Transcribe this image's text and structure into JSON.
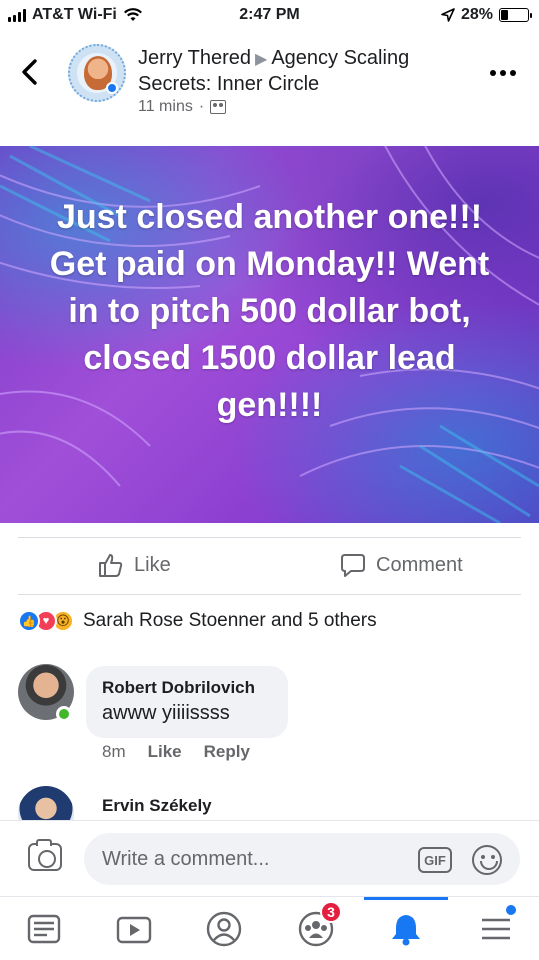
{
  "status_bar": {
    "carrier": "AT&T Wi-Fi",
    "time": "2:47 PM",
    "battery": "28%",
    "battery_level": 0.28
  },
  "post": {
    "author": "Jerry Thered",
    "group": "Agency Scaling Secrets: Inner Circle",
    "time": "11 mins",
    "separator": "·",
    "text": "Just closed another one!!! Get paid on Monday!! Went in to pitch 500 dollar bot, closed 1500 dollar lead gen!!!!"
  },
  "actions": {
    "like": "Like",
    "comment": "Comment"
  },
  "reactions": {
    "icons": [
      "like-icon",
      "love-icon",
      "wow-icon"
    ],
    "summary": "Sarah Rose Stoenner and 5 others"
  },
  "comments": [
    {
      "author": "Robert Dobrilovich",
      "text": "awww yiiiissss",
      "time": "8m",
      "like": "Like",
      "reply": "Reply",
      "online": true
    },
    {
      "author": "Ervin Székely"
    }
  ],
  "composer": {
    "placeholder": "Write a comment...",
    "gif": "GIF"
  },
  "bottom_nav": {
    "items": [
      "news-feed-icon",
      "watch-icon",
      "profile-icon",
      "groups-icon",
      "notifications-icon",
      "menu-icon"
    ],
    "groups_badge": "3",
    "active": "notifications-icon"
  },
  "colors": {
    "accent": "#1877f2",
    "online": "#42b72a",
    "badge": "#e41e3f",
    "post_background": "#9b47d4"
  }
}
